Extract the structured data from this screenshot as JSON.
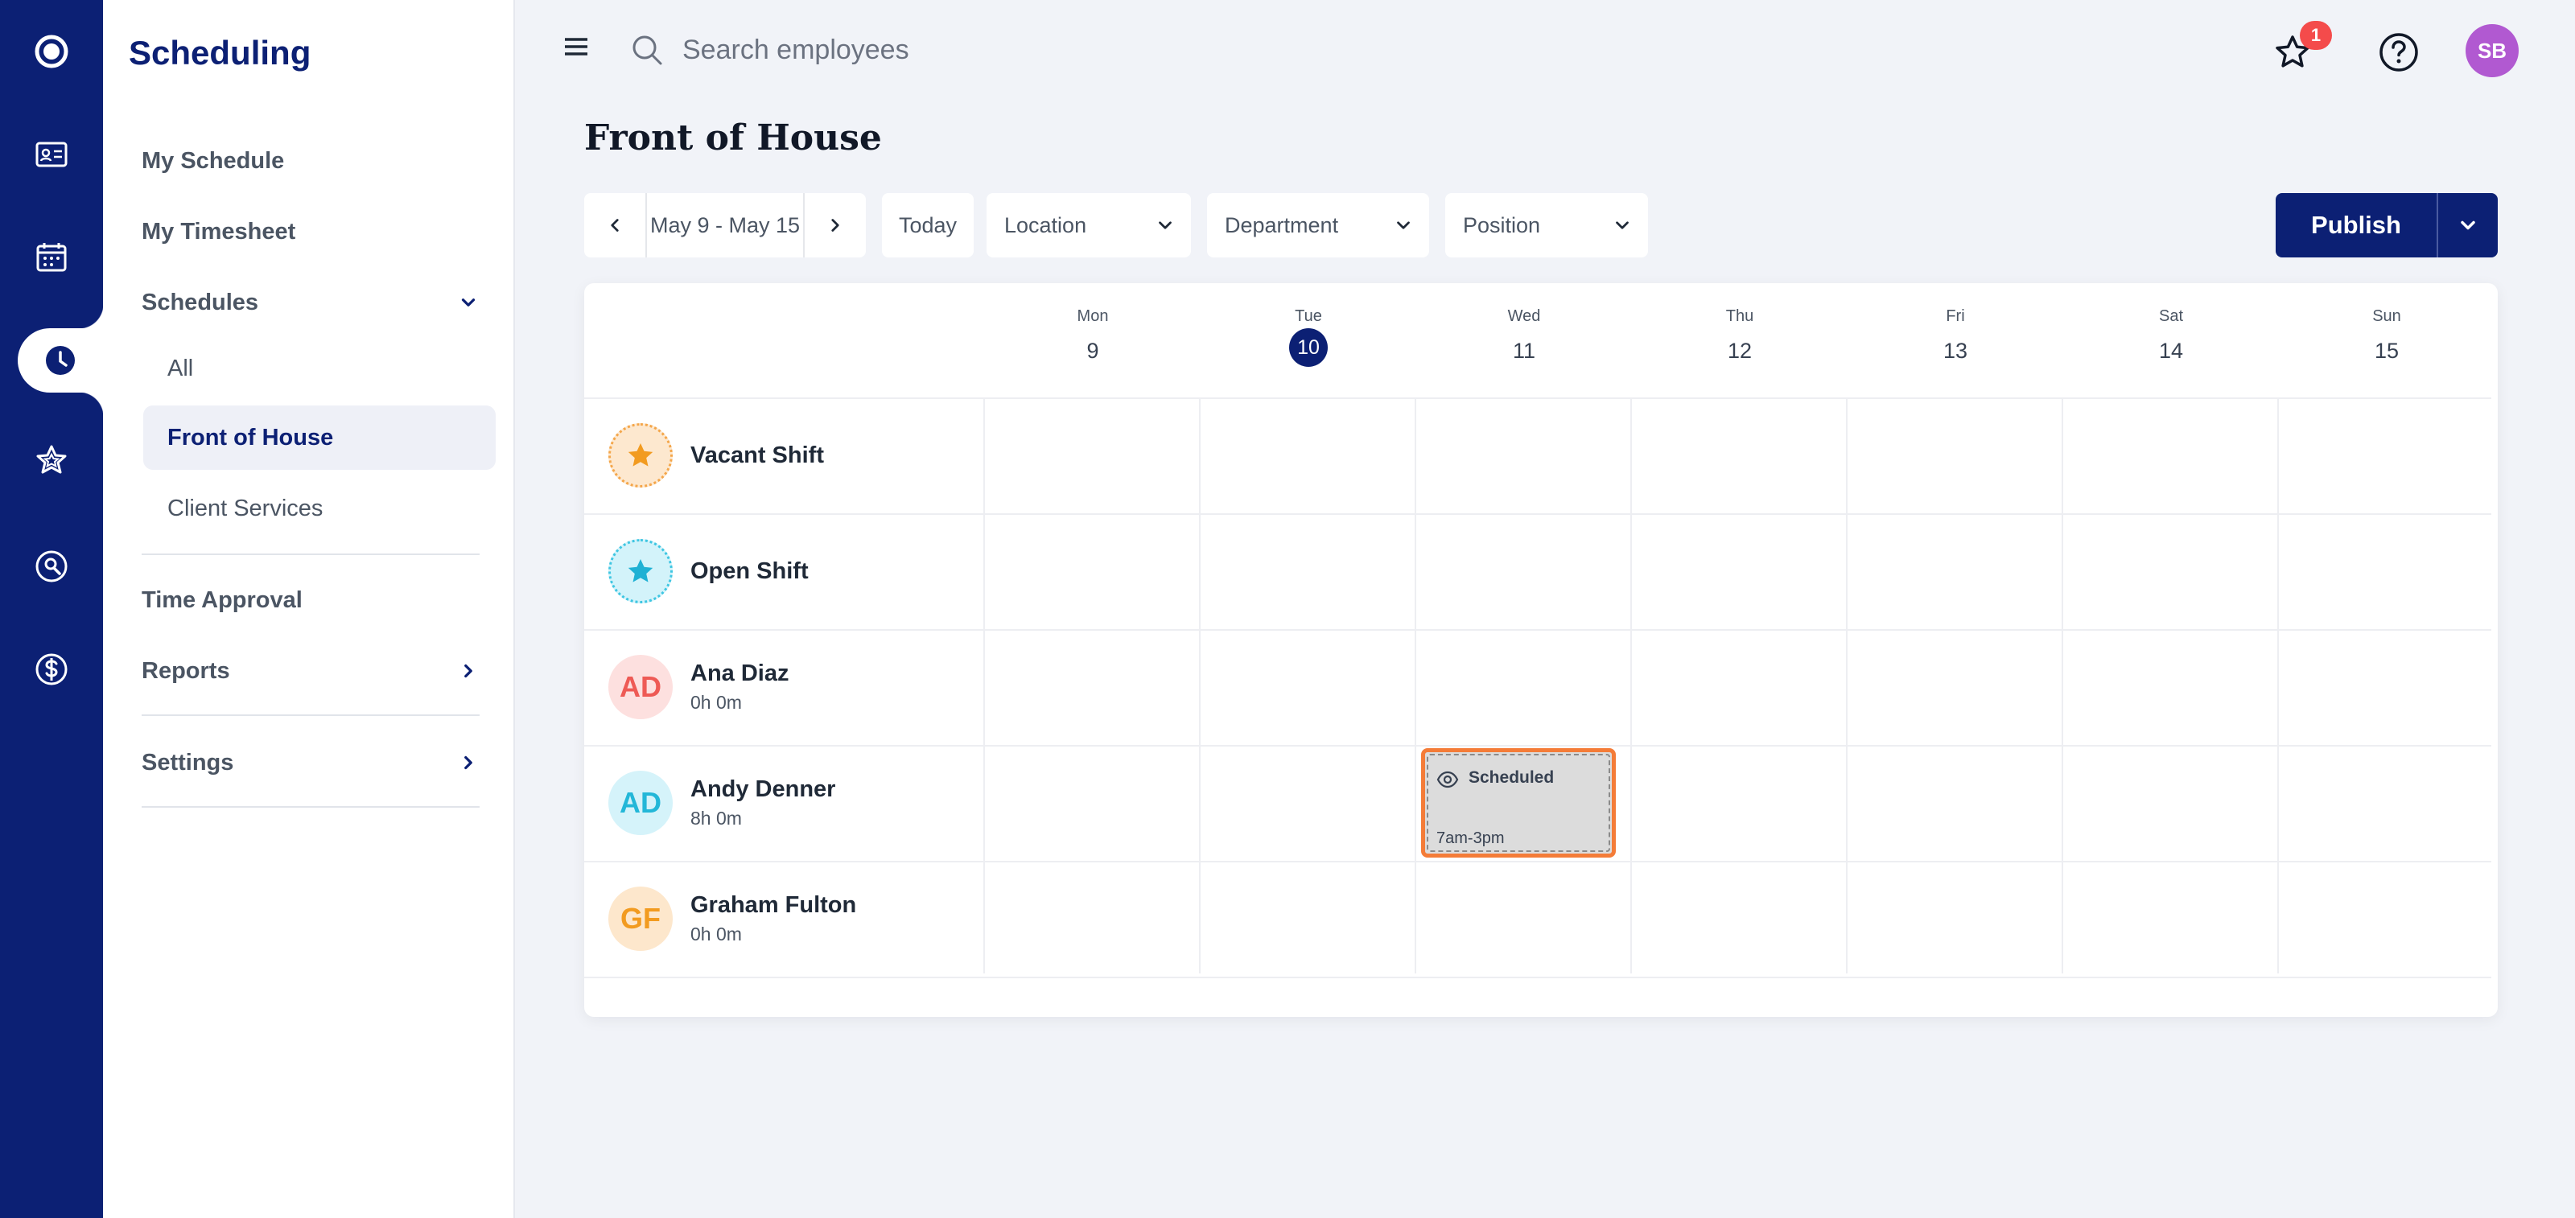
{
  "sidebar": {
    "title": "Scheduling",
    "items": {
      "my_schedule": "My Schedule",
      "my_timesheet": "My Timesheet",
      "schedules": "Schedules",
      "all": "All",
      "front_of_house": "Front of House",
      "client_services": "Client Services",
      "time_approval": "Time Approval",
      "reports": "Reports",
      "settings": "Settings"
    }
  },
  "topbar": {
    "search_placeholder": "Search employees",
    "notification_count": "1",
    "user_initials": "SB"
  },
  "page": {
    "title": "Front of House"
  },
  "toolbar": {
    "date_range": "May 9 - May 15",
    "today": "Today",
    "location": "Location",
    "department": "Department",
    "position": "Position",
    "publish": "Publish"
  },
  "days": [
    {
      "name": "Mon",
      "num": "9"
    },
    {
      "name": "Tue",
      "num": "10"
    },
    {
      "name": "Wed",
      "num": "11"
    },
    {
      "name": "Thu",
      "num": "12"
    },
    {
      "name": "Fri",
      "num": "13"
    },
    {
      "name": "Sat",
      "num": "14"
    },
    {
      "name": "Sun",
      "num": "15"
    }
  ],
  "rows": [
    {
      "name": "Vacant Shift"
    },
    {
      "name": "Open Shift"
    },
    {
      "name": "Ana Diaz",
      "initials": "AD",
      "hours": "0h 0m"
    },
    {
      "name": "Andy Denner",
      "initials": "AD",
      "hours": "8h 0m"
    },
    {
      "name": "Graham Fulton",
      "initials": "GF",
      "hours": "0h 0m"
    }
  ],
  "shift": {
    "status": "Scheduled",
    "time": "7am-3pm"
  },
  "colors": {
    "brand_navy": "#0c2074",
    "shift_border": "#f47c38",
    "badge_red": "#f44b4b",
    "avatar_purple": "#b159d1"
  }
}
